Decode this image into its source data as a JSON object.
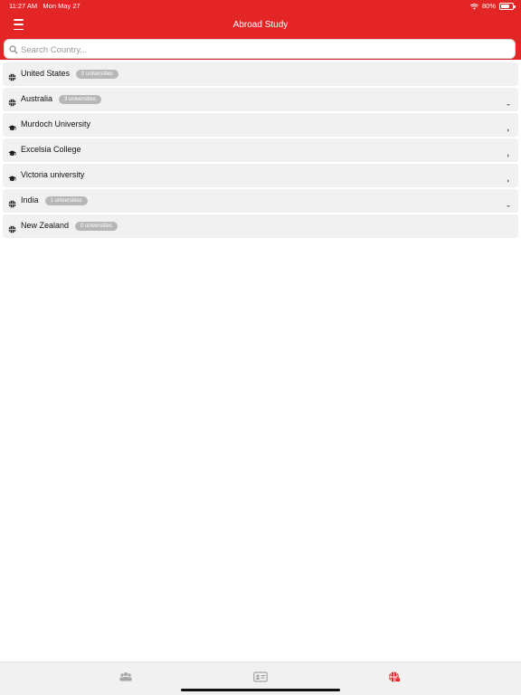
{
  "status_bar": {
    "time": "11:27 AM",
    "date": "Mon May 27",
    "battery": "80%"
  },
  "header": {
    "title": "Abroad Study"
  },
  "search": {
    "placeholder": "Search Country..."
  },
  "rows": [
    {
      "label": "United States",
      "badge": "0 universities",
      "kind": "country",
      "expandable": false
    },
    {
      "label": "Australia",
      "badge": "3 universities",
      "kind": "country",
      "expandable": true
    },
    {
      "label": "Murdoch University",
      "badge": "",
      "kind": "university",
      "expandable": false
    },
    {
      "label": "Excelsia College",
      "badge": "",
      "kind": "university",
      "expandable": false
    },
    {
      "label": "Victoria university",
      "badge": "",
      "kind": "university",
      "expandable": false
    },
    {
      "label": "India",
      "badge": "1 universities",
      "kind": "country",
      "expandable": true
    },
    {
      "label": "New Zealand",
      "badge": "0 universities",
      "kind": "country",
      "expandable": false
    }
  ],
  "tabs": [
    {
      "icon": "people-icon",
      "active": false
    },
    {
      "icon": "id-card-icon",
      "active": false
    },
    {
      "icon": "globe-school-icon",
      "active": true
    }
  ],
  "colors": {
    "accent": "#e32526",
    "badge": "#b7b7b7",
    "row_bg": "#f1f1f1"
  }
}
